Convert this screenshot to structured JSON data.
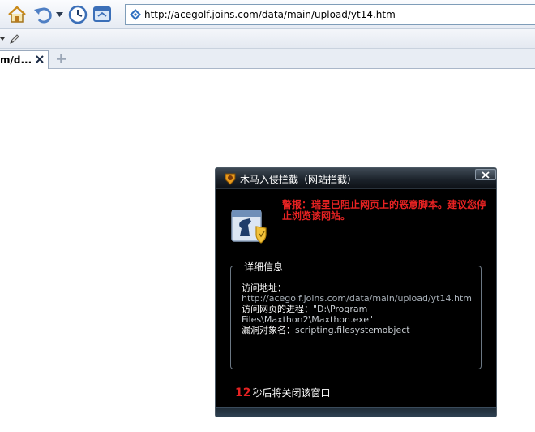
{
  "toolbar": {
    "home_icon": "home-icon",
    "back_icon": "undo-arrow-icon",
    "history_icon": "clock-icon",
    "screen_icon": "window-icon"
  },
  "address": {
    "url": "http://acegolf.joins.com/data/main/upload/yt14.htm"
  },
  "tabs": [
    {
      "label": "m/d...",
      "close_icon": "close-icon"
    }
  ],
  "dialog": {
    "title": "木马入侵拦截（网站拦截）",
    "warning": "警报：瑞星已阻止网页上的恶意脚本。建议您停止浏览该网站。",
    "details_legend": "详细信息",
    "details": {
      "address_label": "访问地址：",
      "address_value": "http://acegolf.joins.com/data/main/upload/yt14.htm",
      "process_label": "访问网页的进程：",
      "process_value": "\"D:\\Program Files\\Maxthon2\\Maxthon.exe\"",
      "object_label": "漏洞对象名：",
      "object_value": "scripting.filesystemobject"
    },
    "countdown_number": "12",
    "countdown_text": "秒后将关闭该窗口"
  },
  "colors": {
    "warning_red": "#e62222",
    "dialog_bg": "#000000"
  }
}
